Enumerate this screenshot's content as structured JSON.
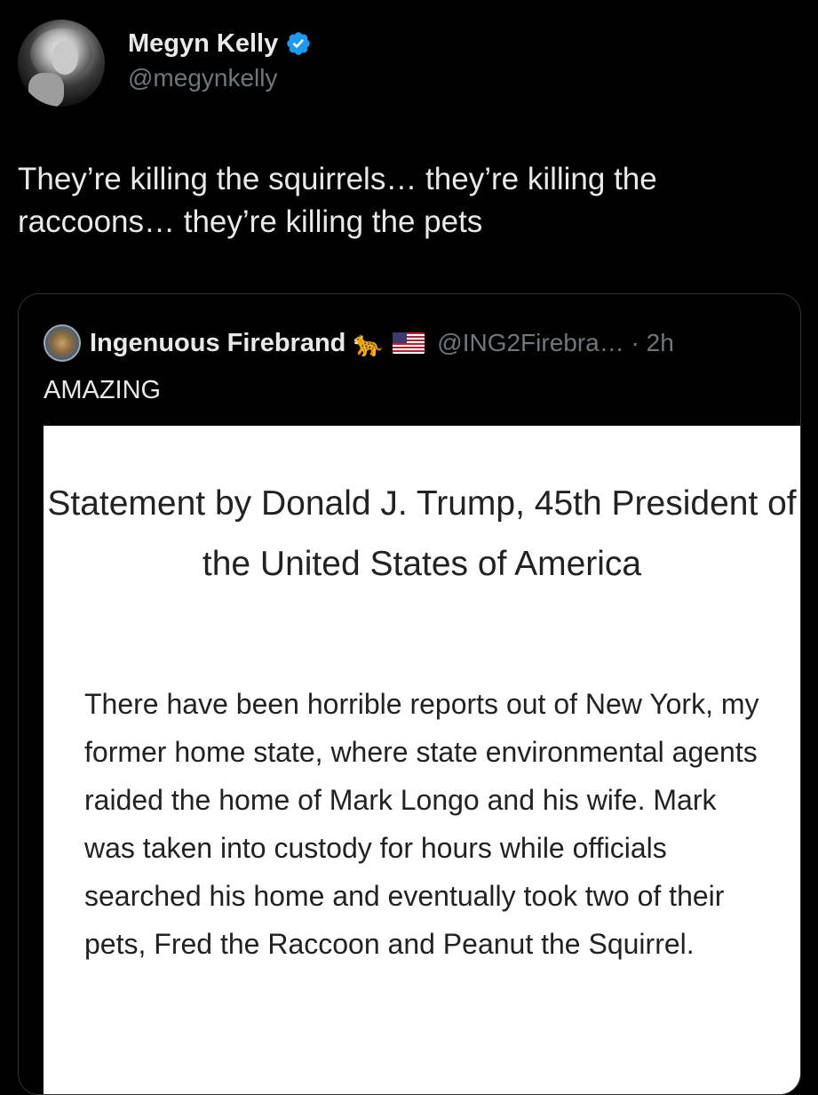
{
  "tweet": {
    "author": {
      "display_name": "Megyn Kelly",
      "handle": "@megynkelly",
      "verified": true,
      "verified_color": "#1d9bf0"
    },
    "text": "They’re killing the squirrels… they’re killing the raccoons… they’re killing the pets"
  },
  "quoted_tweet": {
    "author": {
      "display_name": "Ingenuous Firebrand",
      "emoji_icons": [
        "leopard-emoji-icon",
        "us-flag-emoji-icon"
      ],
      "handle_and_time": "@ING2Firebra… · 2h"
    },
    "text": "AMAZING",
    "image": {
      "title": "Statement by Donald J. Trump, 45th President of the United States of America",
      "body": "There have been horrible reports out of New York, my former home state, where state environmental agents raided the home of Mark Longo and his wife. Mark was taken into custody for hours while officials searched his home and eventually took two of their pets, Fred the Raccoon and Peanut the Squirrel."
    }
  },
  "colors": {
    "background": "#000000",
    "text_primary": "#e7e9ea",
    "text_secondary": "#71767b",
    "border": "#2f3336"
  }
}
